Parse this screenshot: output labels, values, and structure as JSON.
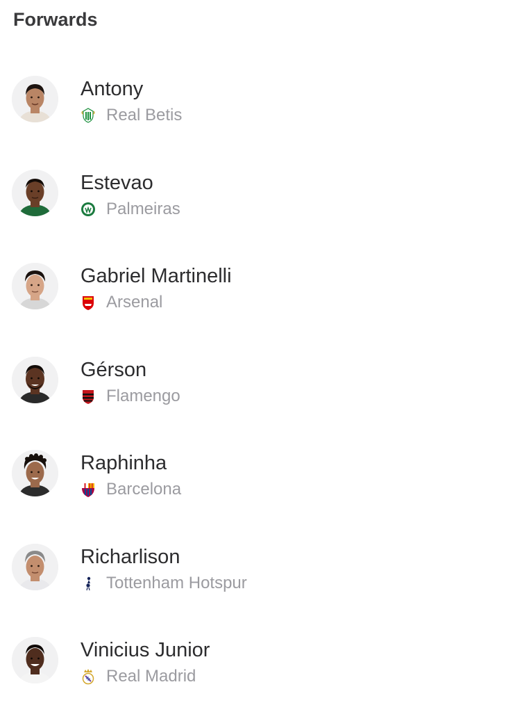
{
  "section": {
    "title": "Forwards"
  },
  "players": [
    {
      "name": "Antony",
      "club": "Real Betis",
      "crest_icon": "real-betis-crest-icon",
      "skin": "#b98565",
      "hair": "#1d1410"
    },
    {
      "name": "Estevao",
      "club": "Palmeiras",
      "crest_icon": "palmeiras-crest-icon",
      "skin": "#6a3f28",
      "hair": "#140c08"
    },
    {
      "name": "Gabriel Martinelli",
      "club": "Arsenal",
      "crest_icon": "arsenal-crest-icon",
      "skin": "#d6a587",
      "hair": "#1b130f"
    },
    {
      "name": "Gérson",
      "club": "Flamengo",
      "crest_icon": "flamengo-crest-icon",
      "skin": "#5b3422",
      "hair": "#120b08"
    },
    {
      "name": "Raphinha",
      "club": "Barcelona",
      "crest_icon": "barcelona-crest-icon",
      "skin": "#9c6a4c",
      "hair": "#160f0b"
    },
    {
      "name": "Richarlison",
      "club": "Tottenham Hotspur",
      "crest_icon": "tottenham-crest-icon",
      "skin": "#c38e6e",
      "hair": "#8a8a8a"
    },
    {
      "name": "Vinicius Junior",
      "club": "Real Madrid",
      "crest_icon": "real-madrid-crest-icon",
      "skin": "#4f2d1e",
      "hair": "#0f0906"
    }
  ]
}
